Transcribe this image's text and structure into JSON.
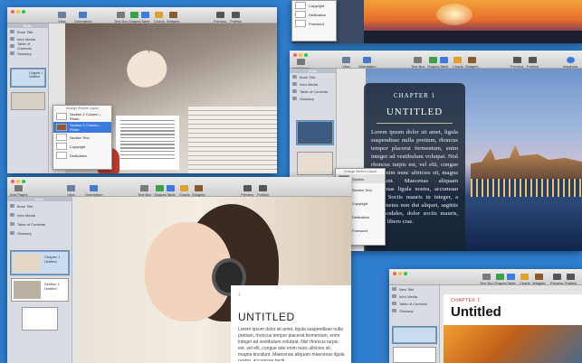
{
  "colors": {
    "background": "#2f7fcf",
    "selection": "#3b7be0",
    "chapter_accent": "#c0392b"
  },
  "window1": {
    "toolbar": [
      {
        "label": "View",
        "icon": "view-icon"
      },
      {
        "label": "Orientation",
        "icon": "orientation-icon"
      },
      {
        "label": "Text Box",
        "icon": "text-box-icon"
      },
      {
        "label": "Shapes",
        "icon": "shapes-icon"
      },
      {
        "label": "Table",
        "icon": "table-icon"
      },
      {
        "label": "Charts",
        "icon": "charts-icon"
      },
      {
        "label": "Widgets",
        "icon": "widgets-icon"
      },
      {
        "label": "Preview",
        "icon": "preview-icon"
      },
      {
        "label": "Publish",
        "icon": "publish-icon"
      }
    ],
    "sidebar_header": "Book",
    "sidebar_items": [
      "Book Title",
      "Intro Media",
      "Table of Contents",
      "Glossary"
    ],
    "chapter_label": "Chapter 1 Untitled",
    "popup": {
      "title": "Change Section Layout",
      "items": [
        "Section 2 Column – Photo",
        "Section 2 Column – Photo",
        "Section Text",
        "Copyright",
        "Dedication"
      ]
    }
  },
  "window2": {
    "toolbar_left": "Add Pages",
    "toolbar": [
      {
        "label": "View",
        "icon": "view-icon"
      },
      {
        "label": "Orientation",
        "icon": "orientation-icon"
      },
      {
        "label": "Text Box",
        "icon": "text-box-icon"
      },
      {
        "label": "Shapes",
        "icon": "shapes-icon"
      },
      {
        "label": "Table",
        "icon": "table-icon"
      },
      {
        "label": "Charts",
        "icon": "charts-icon"
      },
      {
        "label": "Widgets",
        "icon": "widgets-icon"
      },
      {
        "label": "Preview",
        "icon": "preview-icon"
      },
      {
        "label": "Publish",
        "icon": "publish-icon"
      },
      {
        "label": "Inspector",
        "icon": "inspector-icon"
      }
    ],
    "sidebar_header": "Book",
    "sidebar_items": [
      "Book Title",
      "Intro Media",
      "Table of Contents",
      "Glossary"
    ],
    "chapter_heading": "CHAPTER 1",
    "chapter_title": "UNTITLED",
    "chapter_body": "Lorem ipsum dolor sit amet, ligula suspendisse nulla pretium, rhoncus tempor placerat fermentum, enim integer ad vestibulum volutpat. Nisl rhoncus turpis est, vel elit, congue wisi enim nunc ultricies sit, magna tincidunt. Maecenas aliquam maecenas ligula nostra, accumsan taciti. Sociis mauris in integer, a dolor netus non dui aliquet, sagittis felis sodales, dolor sociis mauris, vel eu libero cras.",
    "popup": {
      "title": "Change Section Layout",
      "items": [
        "Section",
        "Section Text",
        "Copyright",
        "Dedication",
        "Foreword"
      ]
    }
  },
  "window3": {
    "toolbar_left": "Add Pages",
    "toolbar": [
      {
        "label": "View",
        "icon": "view-icon"
      },
      {
        "label": "Orientation",
        "icon": "orientation-icon"
      },
      {
        "label": "Text Box",
        "icon": "text-box-icon"
      },
      {
        "label": "Shapes",
        "icon": "shapes-icon"
      },
      {
        "label": "Table",
        "icon": "table-icon"
      },
      {
        "label": "Charts",
        "icon": "charts-icon"
      },
      {
        "label": "Widgets",
        "icon": "widgets-icon"
      },
      {
        "label": "Preview",
        "icon": "preview-icon"
      },
      {
        "label": "Publish",
        "icon": "publish-icon"
      }
    ],
    "sidebar_header": "Book",
    "sidebar_items": [
      "Book Title",
      "Intro Media",
      "Table of Contents",
      "Glossary"
    ],
    "thumb_labels": [
      "Chapter 1 Untitled",
      "Section 1 Untitled"
    ],
    "page_number": "1",
    "page_title": "UNTITLED",
    "page_body": "Lorem ipsum dolor sit amet, ligula suspendisse nulla pretium, rhoncus tempor placerat fermentum, enim integer ad vestibulum volutpat. Nisl rhoncus turpis est, vel elit, congue wisi enim nunc ultricies sit, magna tincidunt. Maecenas aliquam maecenas ligula nostra, accumsan taciti."
  },
  "window4": {
    "sidebar_items": [
      "New Title",
      "Intro Media",
      "Table of Contents",
      "Glossary"
    ],
    "chapter_heading": "CHAPTER 1",
    "chapter_title": "Untitled"
  },
  "window5": {
    "popup_items": [
      "Copyright",
      "Dedication",
      "Foreword"
    ],
    "toolbar": [
      {
        "label": "Text Box",
        "icon": "text-box-icon"
      },
      {
        "label": "Shapes",
        "icon": "shapes-icon"
      },
      {
        "label": "Table",
        "icon": "table-icon"
      },
      {
        "label": "Charts",
        "icon": "charts-icon"
      },
      {
        "label": "Widgets",
        "icon": "widgets-icon"
      },
      {
        "label": "Preview",
        "icon": "preview-icon"
      },
      {
        "label": "Publish",
        "icon": "publish-icon"
      },
      {
        "label": "Inspector",
        "icon": "inspector-icon"
      }
    ]
  }
}
